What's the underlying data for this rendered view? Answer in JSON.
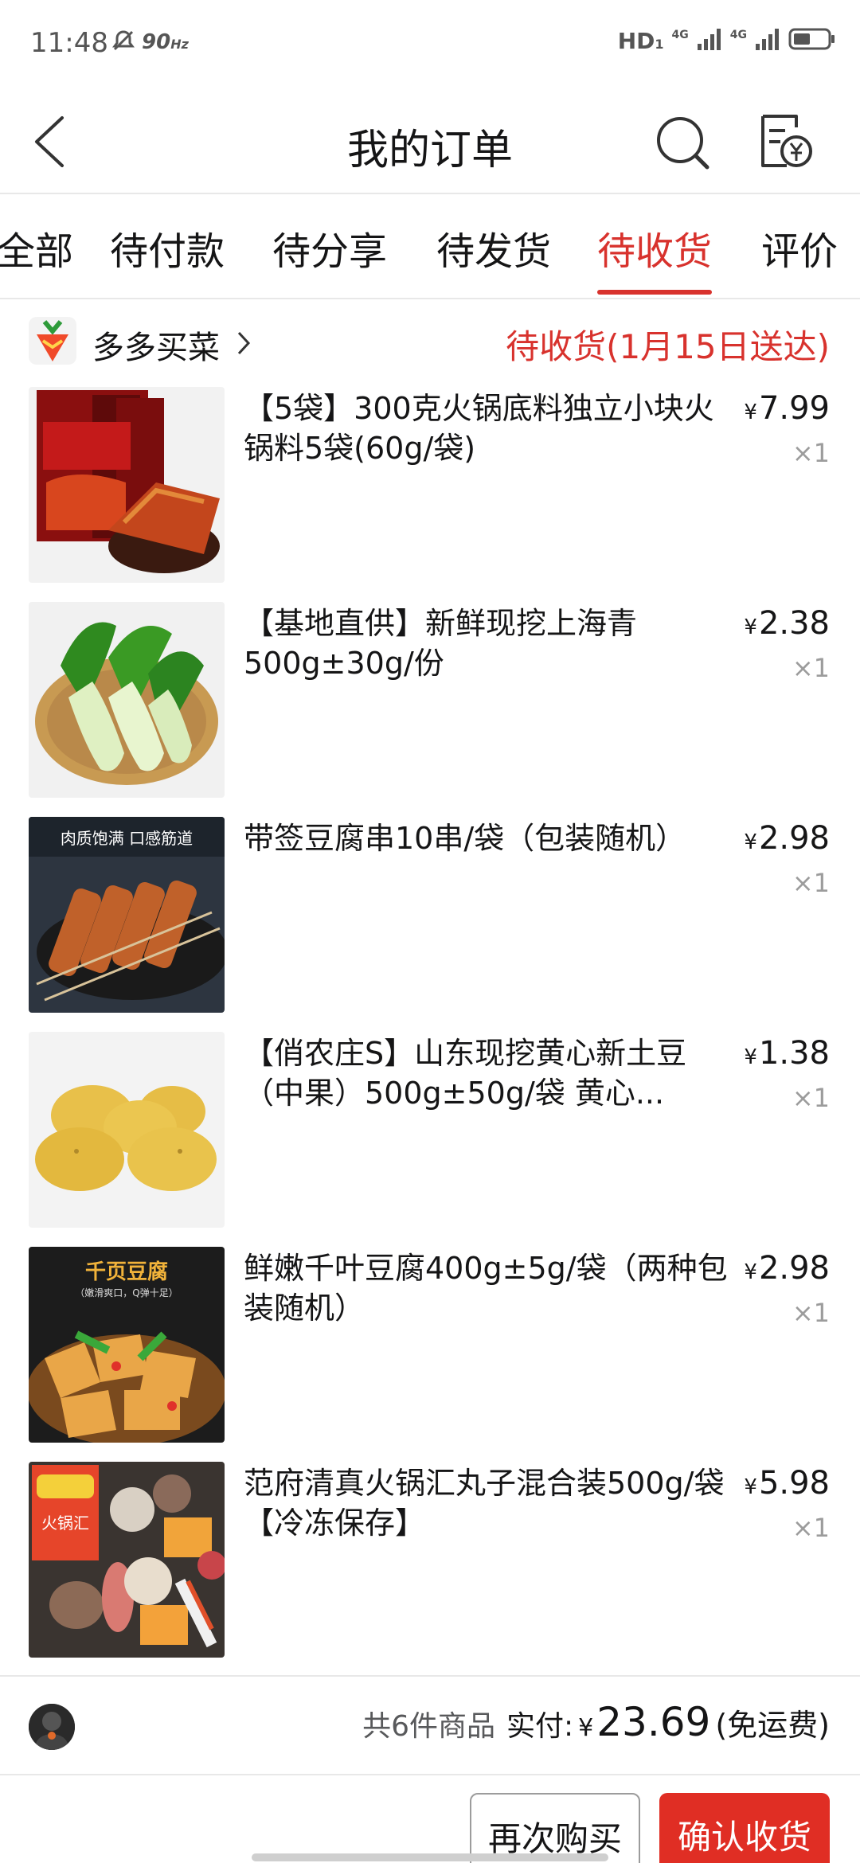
{
  "status_bar": {
    "time": "11:48",
    "refresh_rate": "90",
    "refresh_unit": "Hz",
    "hd_label": "HD",
    "hd_sub": "1",
    "network_1": "4G",
    "network_2": "4G",
    "icons": [
      "mute-bell-icon",
      "signal-icon",
      "signal-icon",
      "battery-icon"
    ]
  },
  "header": {
    "title": "我的订单",
    "icons": [
      "back-arrow-icon",
      "search-icon",
      "bill-icon"
    ]
  },
  "tabs": [
    {
      "label": "全部",
      "active": false
    },
    {
      "label": "待付款",
      "active": false
    },
    {
      "label": "待分享",
      "active": false
    },
    {
      "label": "待发货",
      "active": false
    },
    {
      "label": "待收货",
      "active": true
    },
    {
      "label": "评价",
      "active": false
    }
  ],
  "shop": {
    "name": "多多买菜",
    "status": "待收货(1月15日送达)"
  },
  "items": [
    {
      "title": "【5袋】300克火锅底料独立小块火锅料5袋(60g/袋)",
      "currency": "¥",
      "price": "7.99",
      "qty": "×1",
      "image": "hotpot-base-packets"
    },
    {
      "title": "【基地直供】新鲜现挖上海青500g±30g/份",
      "currency": "¥",
      "price": "2.38",
      "qty": "×1",
      "image": "bok-choy"
    },
    {
      "title": "带签豆腐串10串/袋（包装随机）",
      "currency": "¥",
      "price": "2.98",
      "qty": "×1",
      "image": "tofu-skewers",
      "image_caption": "肉质饱满 口感筋道"
    },
    {
      "title": "【俏农庄S】山东现挖黄心新土豆（中果）500g±50g/袋 黄心...",
      "currency": "¥",
      "price": "1.38",
      "qty": "×1",
      "image": "potatoes"
    },
    {
      "title": "鲜嫩千叶豆腐400g±5g/袋（两种包装随机）",
      "currency": "¥",
      "price": "2.98",
      "qty": "×1",
      "image": "dried-tofu",
      "image_caption": "千页豆腐",
      "image_subcaption": "（嫩滑爽口，Q弹十足）"
    },
    {
      "title": "范府清真火锅汇丸子混合装500g/袋【冷冻保存】",
      "currency": "¥",
      "price": "5.98",
      "qty": "×1",
      "image": "hotpot-balls",
      "image_caption": "火锅汇"
    }
  ],
  "summary": {
    "count_text": "共6件商品",
    "paid_label": "实付:",
    "currency": "¥",
    "amount": "23.69",
    "shipping": "(免运费)"
  },
  "actions": {
    "rebuy": "再次购买",
    "confirm": "确认收货"
  },
  "colors": {
    "accent": "#d8322d",
    "confirm_button": "#e02e24",
    "text_primary": "#151516",
    "text_secondary": "#9c9c9c",
    "divider": "#e8e8e8"
  }
}
